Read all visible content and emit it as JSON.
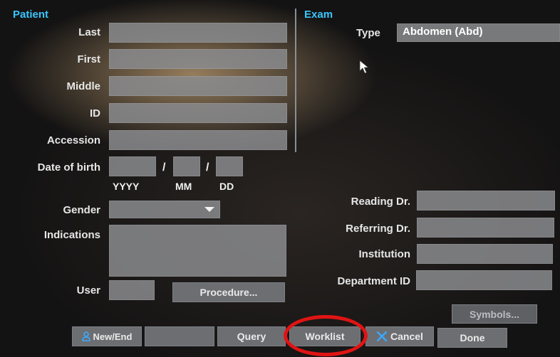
{
  "patient": {
    "section_title": "Patient",
    "labels": {
      "last": "Last",
      "first": "First",
      "middle": "Middle",
      "id": "ID",
      "accession": "Accession",
      "dob": "Date of birth",
      "gender": "Gender",
      "indications": "Indications",
      "user": "User"
    },
    "dob_separator": "/",
    "dob_format": {
      "year": "YYYY",
      "month": "MM",
      "day": "DD"
    },
    "gender_value": "",
    "procedure_button": "Procedure..."
  },
  "exam": {
    "section_title": "Exam",
    "type_label": "Type",
    "type_value": "Abdomen (Abd)",
    "labels": {
      "reading_dr": "Reading Dr.",
      "referring_dr": "Referring Dr.",
      "institution": "Institution",
      "department_id": "Department ID"
    },
    "symbols_button": "Symbols..."
  },
  "footer": {
    "new_end": "New/End",
    "query": "Query",
    "worklist": "Worklist",
    "cancel": "Cancel",
    "done": "Done"
  },
  "colors": {
    "section_title": "#39c6ff",
    "highlight_circle": "#e01414",
    "icon_blue": "#3aa8ff"
  },
  "icons": [
    "mouse-pointer-icon",
    "user-icon",
    "cancel-x-icon",
    "chevron-down-icon"
  ]
}
